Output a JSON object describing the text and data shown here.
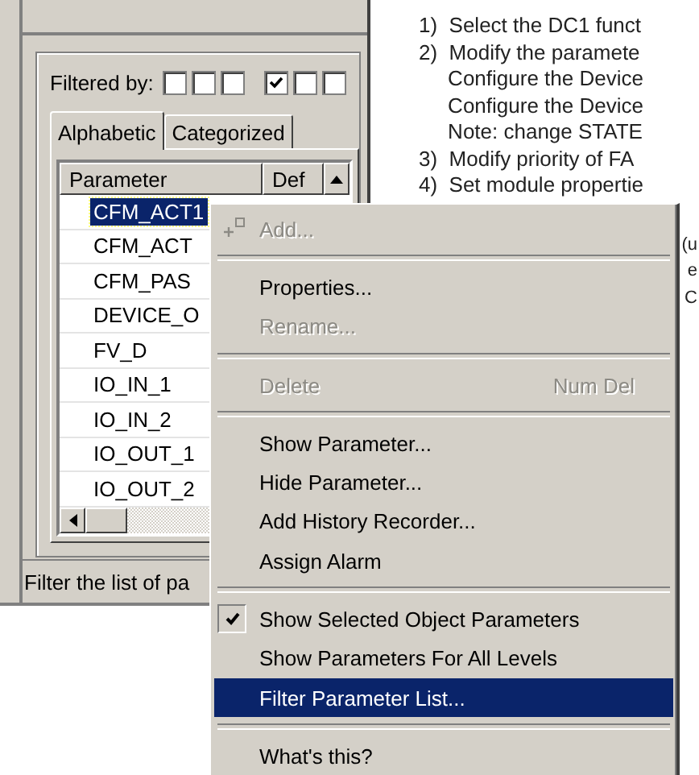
{
  "parameter_panel": {
    "filter": {
      "label": "Filtered by:",
      "checkboxes": [
        {
          "checked": false
        },
        {
          "checked": false
        },
        {
          "checked": false
        },
        {
          "checked": true
        },
        {
          "checked": false
        },
        {
          "checked": false
        }
      ]
    },
    "tabs": [
      {
        "label": "Alphabetic",
        "selected": true
      },
      {
        "label": "Categorized",
        "selected": false
      }
    ],
    "table": {
      "columns": [
        "Parameter",
        "Def"
      ],
      "rows": [
        {
          "name": "CFM_ACT1",
          "selected": true
        },
        {
          "name": "CFM_ACT",
          "selected": false
        },
        {
          "name": "CFM_PAS",
          "selected": false
        },
        {
          "name": "DEVICE_O",
          "selected": false
        },
        {
          "name": "FV_D",
          "selected": false
        },
        {
          "name": "IO_IN_1",
          "selected": false
        },
        {
          "name": "IO_IN_2",
          "selected": false
        },
        {
          "name": "IO_OUT_1",
          "selected": false
        },
        {
          "name": "IO_OUT_2",
          "selected": false
        }
      ]
    },
    "status_bar": "Filter the list of pa"
  },
  "instructions": [
    "1)  Select the DC1 funct",
    "2)  Modify the paramete",
    "     Configure the Device",
    "     Configure the Device",
    "     Note: change STATE",
    "3)  Modify priority of FA",
    "4)  Set module propertie"
  ],
  "instruction_fragments": [
    "(u",
    "e",
    "C"
  ],
  "context_menu": [
    {
      "kind": "item",
      "label": "Add...",
      "disabled": true,
      "checked": false,
      "selected": false
    },
    {
      "kind": "separator"
    },
    {
      "kind": "item",
      "label": "Properties...",
      "disabled": false,
      "checked": false,
      "selected": false
    },
    {
      "kind": "item",
      "label": "Rename...",
      "disabled": true,
      "checked": false,
      "selected": false
    },
    {
      "kind": "separator"
    },
    {
      "kind": "item",
      "label": "Delete",
      "shortcut": "Num Del",
      "disabled": true,
      "checked": false,
      "selected": false
    },
    {
      "kind": "separator"
    },
    {
      "kind": "item",
      "label": "Show Parameter...",
      "disabled": false,
      "checked": false,
      "selected": false
    },
    {
      "kind": "item",
      "label": "Hide Parameter...",
      "disabled": false,
      "checked": false,
      "selected": false
    },
    {
      "kind": "item",
      "label": "Add History Recorder...",
      "disabled": false,
      "checked": false,
      "selected": false
    },
    {
      "kind": "item",
      "label": "Assign Alarm",
      "disabled": false,
      "checked": false,
      "selected": false
    },
    {
      "kind": "separator"
    },
    {
      "kind": "item",
      "label": "Show Selected Object Parameters",
      "disabled": false,
      "checked": true,
      "selected": false
    },
    {
      "kind": "item",
      "label": "Show Parameters For All Levels",
      "disabled": false,
      "checked": false,
      "selected": false
    },
    {
      "kind": "item",
      "label": "Filter Parameter List...",
      "disabled": false,
      "checked": false,
      "selected": true
    },
    {
      "kind": "separator"
    },
    {
      "kind": "item",
      "label": "What's this?",
      "disabled": false,
      "checked": false,
      "selected": false
    }
  ]
}
